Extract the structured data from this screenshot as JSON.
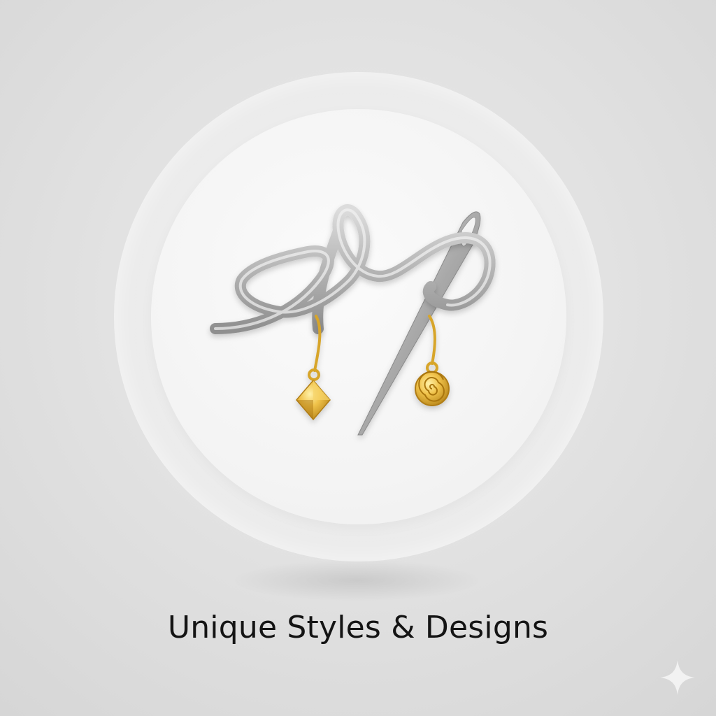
{
  "caption": {
    "text": "Unique Styles & Designs"
  },
  "icons": {
    "main_emblem": "thread-needle-earrings-icon",
    "left_charm": "gold-diamond-charm-icon",
    "right_charm": "gold-spiral-charm-icon",
    "corner_mark": "sparkle-icon"
  },
  "colors": {
    "background": "#dcdcdc",
    "disc": "#f4f4f4",
    "thread": "#b9b9b9",
    "gold": "#e2b43a",
    "caption_text": "#141414"
  }
}
